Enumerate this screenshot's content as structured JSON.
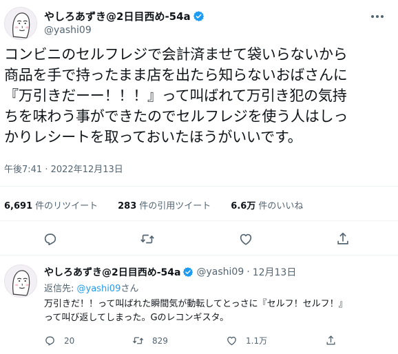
{
  "main_tweet": {
    "display_name": "やしろあずき@2日目西め-54a",
    "handle": "@yashi09",
    "text_lines": [
      "コンビニのセルフレジで会計済ませて袋いらないから",
      "商品を手で持ったまま店を出たら知らないおばさんに",
      "『万引きだーー！！！』って叫ばれて万引き犯の気持",
      "ちを味わう事ができたのでセルフレジを使う人はしっ",
      "かりレシートを取っておいたほうがいいです。"
    ],
    "timestamp": "午後7:41 · 2022年12月13日",
    "stats": {
      "retweets_count": "6,691",
      "retweets_label": "件のリツイート",
      "quotes_count": "283",
      "quotes_label": "件の引用ツイート",
      "likes_count": "6.6万",
      "likes_label": "件のいいね"
    },
    "actions": [
      "reply-icon",
      "retweet-icon",
      "like-icon",
      "share-icon"
    ]
  },
  "reply_tweet": {
    "display_name": "やしろあずき@2日目西め-54a",
    "handle": "@yashi09",
    "separator": "·",
    "date": "12月13日",
    "reply_to_prefix": "返信先: ",
    "reply_to_handle": "@yashi09",
    "reply_to_suffix": "さん",
    "text_lines": [
      "万引きだ！！って叫ばれた瞬間気が動転してとっさに『セルフ！セルフ！』",
      "って叫び返してしまった。Gのレコンギスタ。"
    ],
    "reply_count": "20",
    "retweet_count": "829",
    "like_count": "1.1万"
  },
  "colors": {
    "text": "#0f1419",
    "secondary": "#536471",
    "accent": "#1d9bf0",
    "divider": "#eff3f4"
  }
}
